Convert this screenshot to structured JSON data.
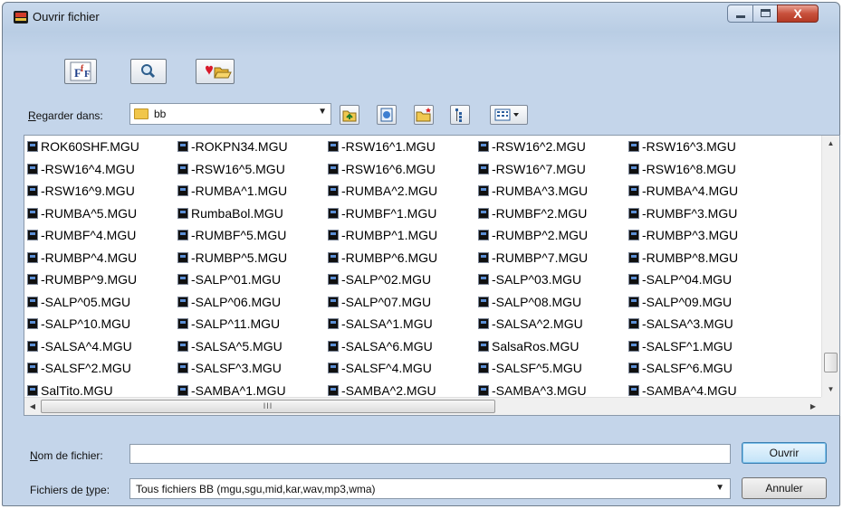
{
  "window": {
    "title": "Ouvrir fichier"
  },
  "title_buttons": {
    "minimize_icon": "minimize-icon",
    "maximize_icon": "maximize-icon",
    "close": "X"
  },
  "toolbar": {
    "icons": [
      "font-icon",
      "search-icon",
      "favorite-folder-icon"
    ]
  },
  "look_in": {
    "label_prefix": "R",
    "label_rest": "egarder dans:",
    "value": "bb",
    "folder_icon": "folder-icon"
  },
  "nav_icons": [
    "up-folder-icon",
    "back-icon",
    "new-folder-icon",
    "list-view-icon",
    "view-menu-icon"
  ],
  "files": [
    [
      "ROK60SHF.MGU",
      "-ROKPN34.MGU",
      "-RSW16^1.MGU",
      "-RSW16^2.MGU",
      "-RSW16^3.MGU"
    ],
    [
      "-RSW16^4.MGU",
      "-RSW16^5.MGU",
      "-RSW16^6.MGU",
      "-RSW16^7.MGU",
      "-RSW16^8.MGU"
    ],
    [
      "-RSW16^9.MGU",
      "-RUMBA^1.MGU",
      "-RUMBA^2.MGU",
      "-RUMBA^3.MGU",
      "-RUMBA^4.MGU"
    ],
    [
      "-RUMBA^5.MGU",
      "RumbaBol.MGU",
      "-RUMBF^1.MGU",
      "-RUMBF^2.MGU",
      "-RUMBF^3.MGU"
    ],
    [
      "-RUMBF^4.MGU",
      "-RUMBF^5.MGU",
      "-RUMBP^1.MGU",
      "-RUMBP^2.MGU",
      "-RUMBP^3.MGU"
    ],
    [
      "-RUMBP^4.MGU",
      "-RUMBP^5.MGU",
      "-RUMBP^6.MGU",
      "-RUMBP^7.MGU",
      "-RUMBP^8.MGU"
    ],
    [
      "-RUMBP^9.MGU",
      "-SALP^01.MGU",
      "-SALP^02.MGU",
      "-SALP^03.MGU",
      "-SALP^04.MGU"
    ],
    [
      "-SALP^05.MGU",
      "-SALP^06.MGU",
      "-SALP^07.MGU",
      "-SALP^08.MGU",
      "-SALP^09.MGU"
    ],
    [
      "-SALP^10.MGU",
      "-SALP^11.MGU",
      "-SALSA^1.MGU",
      "-SALSA^2.MGU",
      "-SALSA^3.MGU"
    ],
    [
      "-SALSA^4.MGU",
      "-SALSA^5.MGU",
      "-SALSA^6.MGU",
      "SalsaRos.MGU",
      "-SALSF^1.MGU"
    ],
    [
      "-SALSF^2.MGU",
      "-SALSF^3.MGU",
      "-SALSF^4.MGU",
      "-SALSF^5.MGU",
      "-SALSF^6.MGU"
    ],
    [
      "SalTito.MGU",
      "-SAMBA^1.MGU",
      "-SAMBA^2.MGU",
      "-SAMBA^3.MGU",
      "-SAMBA^4.MGU"
    ]
  ],
  "scroll": {
    "hgrip": "III"
  },
  "filename": {
    "label_prefix": "N",
    "label_rest": "om de fichier:",
    "value": "",
    "placeholder": ""
  },
  "filetype": {
    "label_before": "Fichiers de ",
    "label_underline": "t",
    "label_after": "ype:",
    "value": "Tous fichiers BB (mgu,sgu,mid,kar,wav,mp3,wma)"
  },
  "buttons": {
    "open": "Ouvrir",
    "cancel": "Annuler"
  }
}
